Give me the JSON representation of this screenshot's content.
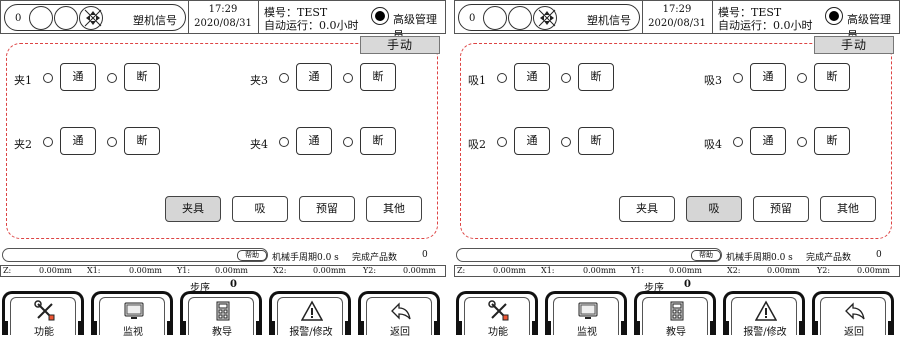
{
  "header": {
    "value": "0",
    "machine_signal": "塑机信号",
    "time": "17:29",
    "date": "2020/08/31",
    "mold_label": "模号：TEST",
    "auto_run_label": "自动运行：0.0小时",
    "user_level": "高级管理员"
  },
  "mode_label": "手动",
  "left_panel": {
    "rows": [
      {
        "label_left": "夹1",
        "label_right": "夹3"
      },
      {
        "label_left": "夹2",
        "label_right": "夹4"
      }
    ]
  },
  "right_panel": {
    "rows": [
      {
        "label_left": "吸1",
        "label_right": "吸3"
      },
      {
        "label_left": "吸2",
        "label_right": "吸4"
      }
    ]
  },
  "toggle": {
    "on": "通",
    "off": "断"
  },
  "categories": [
    "夹具",
    "吸",
    "预留",
    "其他"
  ],
  "left_active_category": 0,
  "right_active_category": 1,
  "info": {
    "help": "帮助",
    "cycle_label": "机械手周期0.0 s",
    "finished_label": "完成产品数",
    "finished_value": "0"
  },
  "axes": [
    {
      "name": "Z:",
      "value": "0.00mm"
    },
    {
      "name": "X1:",
      "value": "0.00mm"
    },
    {
      "name": "Y1:",
      "value": "0.00mm"
    },
    {
      "name": "X2:",
      "value": "0.00mm"
    },
    {
      "name": "Y2:",
      "value": "0.00mm"
    }
  ],
  "step": {
    "label": "步序",
    "value": "0"
  },
  "nav": [
    {
      "label": "功能",
      "icon": "tools-icon"
    },
    {
      "label": "监视",
      "icon": "monitor-icon"
    },
    {
      "label": "教导",
      "icon": "teach-icon"
    },
    {
      "label": "报警/修改",
      "icon": "warning-icon"
    },
    {
      "label": "返回",
      "icon": "back-arrow-icon"
    }
  ]
}
